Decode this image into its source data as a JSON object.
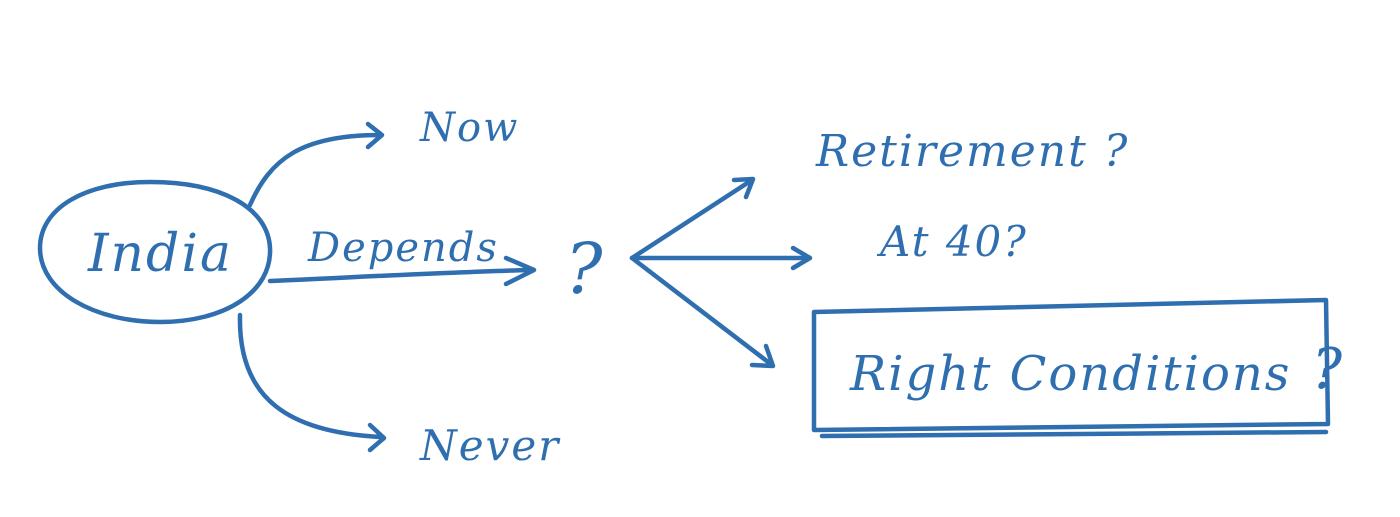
{
  "diagram": {
    "ink_color": "#2f6fb0",
    "center_node": "India",
    "branches": {
      "now": "Now",
      "depends": "Depends",
      "never": "Never"
    },
    "depends_target": "?",
    "options": {
      "retirement": "Retirement ?",
      "at_40": "At 40?",
      "right_conditions": "Right Conditions",
      "right_conditions_mark": "?"
    }
  }
}
